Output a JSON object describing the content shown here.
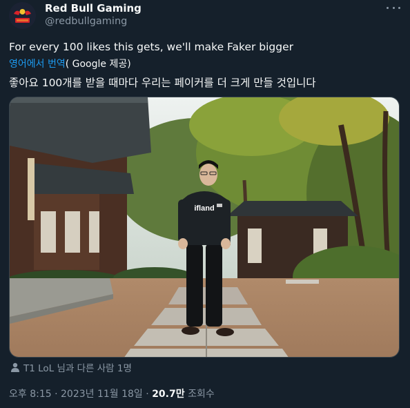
{
  "author": {
    "display_name": "Red Bull Gaming",
    "handle": "@redbullgaming",
    "avatar_text": "Red Bull"
  },
  "tweet": {
    "text": "For every 100 likes this gets, we'll make Faker bigger",
    "translate_link": "영어에서 번역",
    "translate_provider": "( Google 제공)",
    "translated_text": "좋아요 100개를 받을 때마다 우리는 페이커를 더 크게 만들 것입니다"
  },
  "photo": {
    "jersey_text": "ifland"
  },
  "tagged": {
    "text": "T1 LoL 님과 다른 사람 1명"
  },
  "meta": {
    "time": "오후 8:15",
    "sep1": " · ",
    "date": "2023년 11월 18일",
    "sep2": " · ",
    "views_count": "20.7만",
    "views_label": " 조회수"
  },
  "colors": {
    "background": "#15202b",
    "text": "#f7f9f9",
    "secondary": "#8b98a5",
    "link": "#1d9bf0"
  },
  "icons": [
    "more-icon",
    "person-tag-icon"
  ]
}
